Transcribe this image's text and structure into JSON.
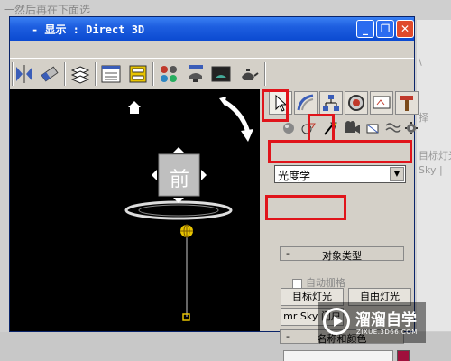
{
  "background": {
    "left_text": "一然后再在下面选",
    "right_fragments": [
      "\\",
      "择",
      "目标灯光",
      "Sky |"
    ]
  },
  "window": {
    "title": "- 显示 : Direct 3D",
    "minimize_label": "_",
    "maximize_label": "❐",
    "close_label": "✕"
  },
  "viewcube": {
    "face_label": "前"
  },
  "command_panel": {
    "dropdown_value": "光度学",
    "object_type": {
      "header": "对象类型",
      "minus": "-",
      "autogrid_label": "自动栅格",
      "buttons": [
        "目标灯光",
        "自由灯光",
        "mr Sky 门户"
      ]
    },
    "name_color": {
      "header": "名称和颜色",
      "minus": "-",
      "name_value": ""
    },
    "swatch_color": "#a0103c"
  },
  "highlights": [
    "tab-create",
    "subtab-lights",
    "dropdown-category",
    "button-target-light"
  ],
  "watermark": {
    "title": "溜溜自学",
    "subtitle": "ZIXUE.3D66.COM"
  },
  "colors": {
    "title_blue": "#1e5fe0",
    "highlight_red": "#e0141b",
    "light_yellow": "#e8c400"
  }
}
